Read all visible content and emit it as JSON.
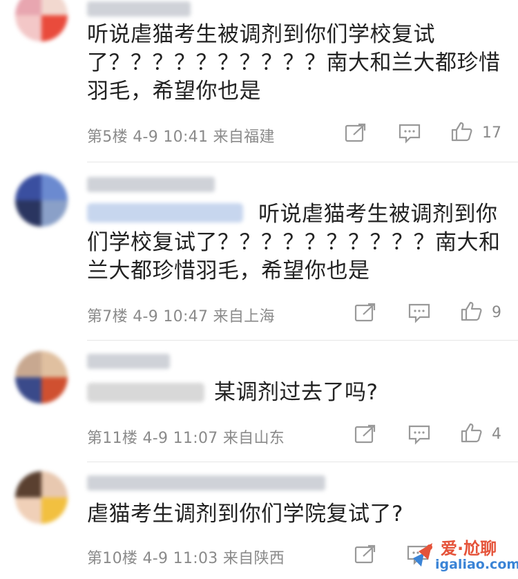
{
  "comments": [
    {
      "text": "听说虐猫考生被调剂到你们学校复试了？？？？？？？？？？南大和兰大都珍惜羽毛，希望你也是",
      "floor": "第5楼",
      "date": "4-9",
      "time": "10:41",
      "location": "来自福建",
      "likes": "17"
    },
    {
      "text": "听说虐猫考生被调剂到你们学校复试了？？？？？？？？？？南大和兰大都珍惜羽毛，希望你也是",
      "floor": "第7楼",
      "date": "4-9",
      "time": "10:47",
      "location": "来自上海",
      "likes": "9"
    },
    {
      "text": "某调剂过去了吗?",
      "floor": "第11楼",
      "date": "4-9",
      "time": "11:07",
      "location": "来自山东",
      "likes": "4"
    },
    {
      "text": "虐猫考生调剂到你们学院复试了?",
      "floor": "第10楼",
      "date": "4-9",
      "time": "11:03",
      "location": "来自陕西",
      "likes": ""
    }
  ],
  "icons": {
    "share": "share-icon",
    "reply": "comment-icon",
    "like": "thumbs-up-icon"
  },
  "watermark": {
    "title": "爱·尬聊",
    "url": "igaliao.com"
  },
  "colors": {
    "meta_gray": "#8a8a8a",
    "watermark_red": "#e5533a",
    "watermark_blue": "#3b84d6"
  }
}
